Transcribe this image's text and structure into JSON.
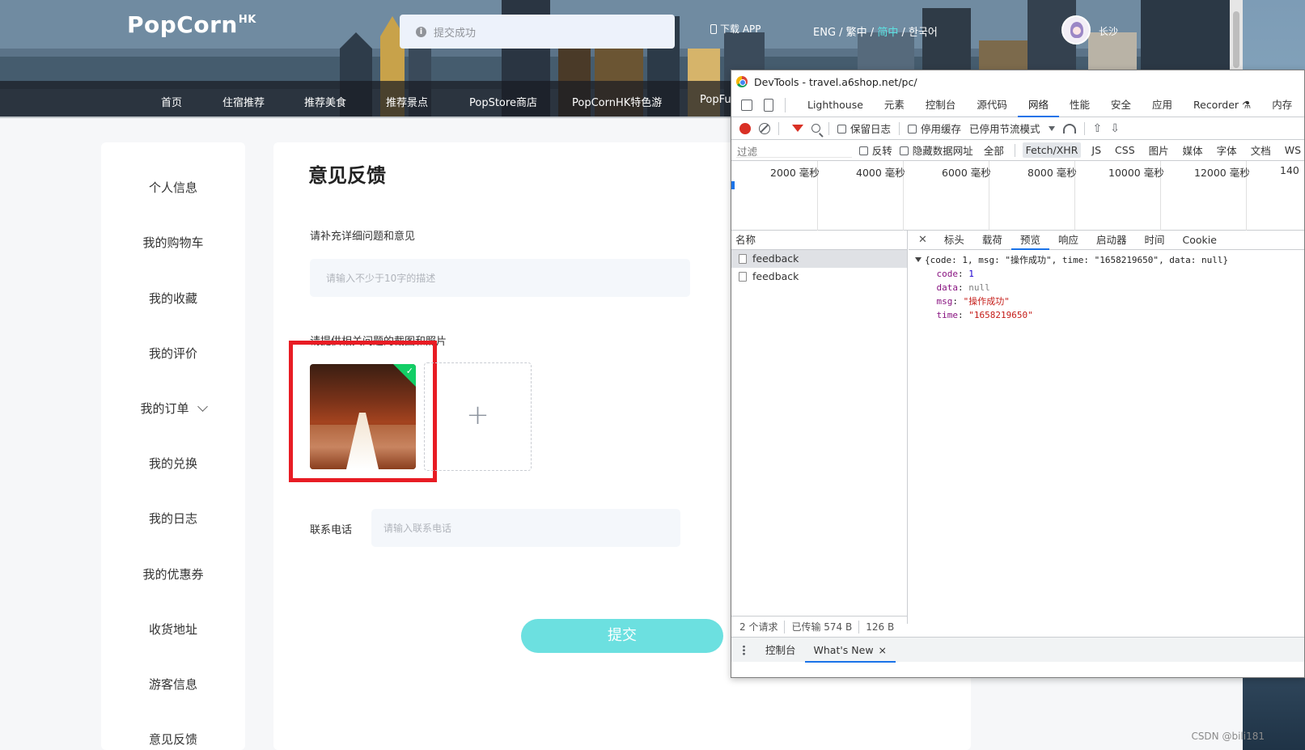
{
  "header": {
    "logo_text": "PopCorn",
    "logo_sup": "HK",
    "toast_text": "提交成功",
    "download_app": "下载 APP",
    "lang_eng": "ENG /",
    "lang_trad": " 繁中 /",
    "lang_simp": " 简中",
    "lang_kor": " / 한국어",
    "user_name": "长沙",
    "nav": [
      "首页",
      "住宿推荐",
      "推荐美食",
      "推荐景点",
      "PopStore商店",
      "PopCornHK特色游",
      "PopFun"
    ]
  },
  "sidebar": {
    "items": [
      "个人信息",
      "我的购物车",
      "我的收藏",
      "我的评价",
      "我的订单",
      "我的兑换",
      "我的日志",
      "我的优惠券",
      "收货地址",
      "游客信息",
      "意见反馈"
    ]
  },
  "feedback": {
    "title": "意见反馈",
    "desc_label": "请补充详细问题和意见",
    "desc_placeholder": "请输入不少于10字的描述",
    "photo_label": "请提供相关问题的截图和照片",
    "phone_label": "联系电话",
    "phone_placeholder": "请输入联系电话",
    "add_symbol": "+",
    "submit": "提交"
  },
  "devtools": {
    "title": "DevTools - travel.a6shop.net/pc/",
    "tabs": [
      "Lighthouse",
      "元素",
      "控制台",
      "源代码",
      "网络",
      "性能",
      "安全",
      "应用",
      "Recorder ⚗",
      "内存"
    ],
    "active_tab": "网络",
    "toolbar": {
      "preserve_log": "保留日志",
      "disable_cache": "停用缓存",
      "throttle": "已停用节流模式"
    },
    "filter": {
      "placeholder": "过滤",
      "invert": "反转",
      "hide_data": "隐藏数据网址",
      "chips": [
        "全部",
        "Fetch/XHR",
        "JS",
        "CSS",
        "图片",
        "媒体",
        "字体",
        "文档",
        "WS"
      ],
      "active_chip": "Fetch/XHR"
    },
    "timeline_labels": [
      "2000 毫秒",
      "4000 毫秒",
      "6000 毫秒",
      "8000 毫秒",
      "10000 毫秒",
      "12000 毫秒",
      "140"
    ],
    "names_header": "名称",
    "requests": [
      "feedback",
      "feedback"
    ],
    "status": {
      "requests": "2 个请求",
      "transferred": "已传输 574 B",
      "resources": "126 B"
    },
    "preview_tabs": [
      "标头",
      "载荷",
      "预览",
      "响应",
      "启动器",
      "时间",
      "Cookie"
    ],
    "active_preview_tab": "预览",
    "json": {
      "summary_open": "{code: 1, msg: ",
      "summary_msg": "\"操作成功\"",
      "summary_mid": ", time: ",
      "summary_time": "\"1658219650\"",
      "summary_end": ", data: null}",
      "code_key": "code",
      "code_val": "1",
      "data_key": "data",
      "data_val": "null",
      "msg_key": "msg",
      "msg_val": "\"操作成功\"",
      "time_key": "time",
      "time_val": "\"1658219650\""
    },
    "drawer_tabs": [
      "控制台",
      "What's New"
    ],
    "drawer_close": "×"
  },
  "watermark": "CSDN @bili181",
  "colors": {
    "accent_teal": "#6ce0e0",
    "highlight_red": "#e81c24",
    "devtools_blue": "#1a73e8",
    "upload_success_green": "#13ce66"
  }
}
